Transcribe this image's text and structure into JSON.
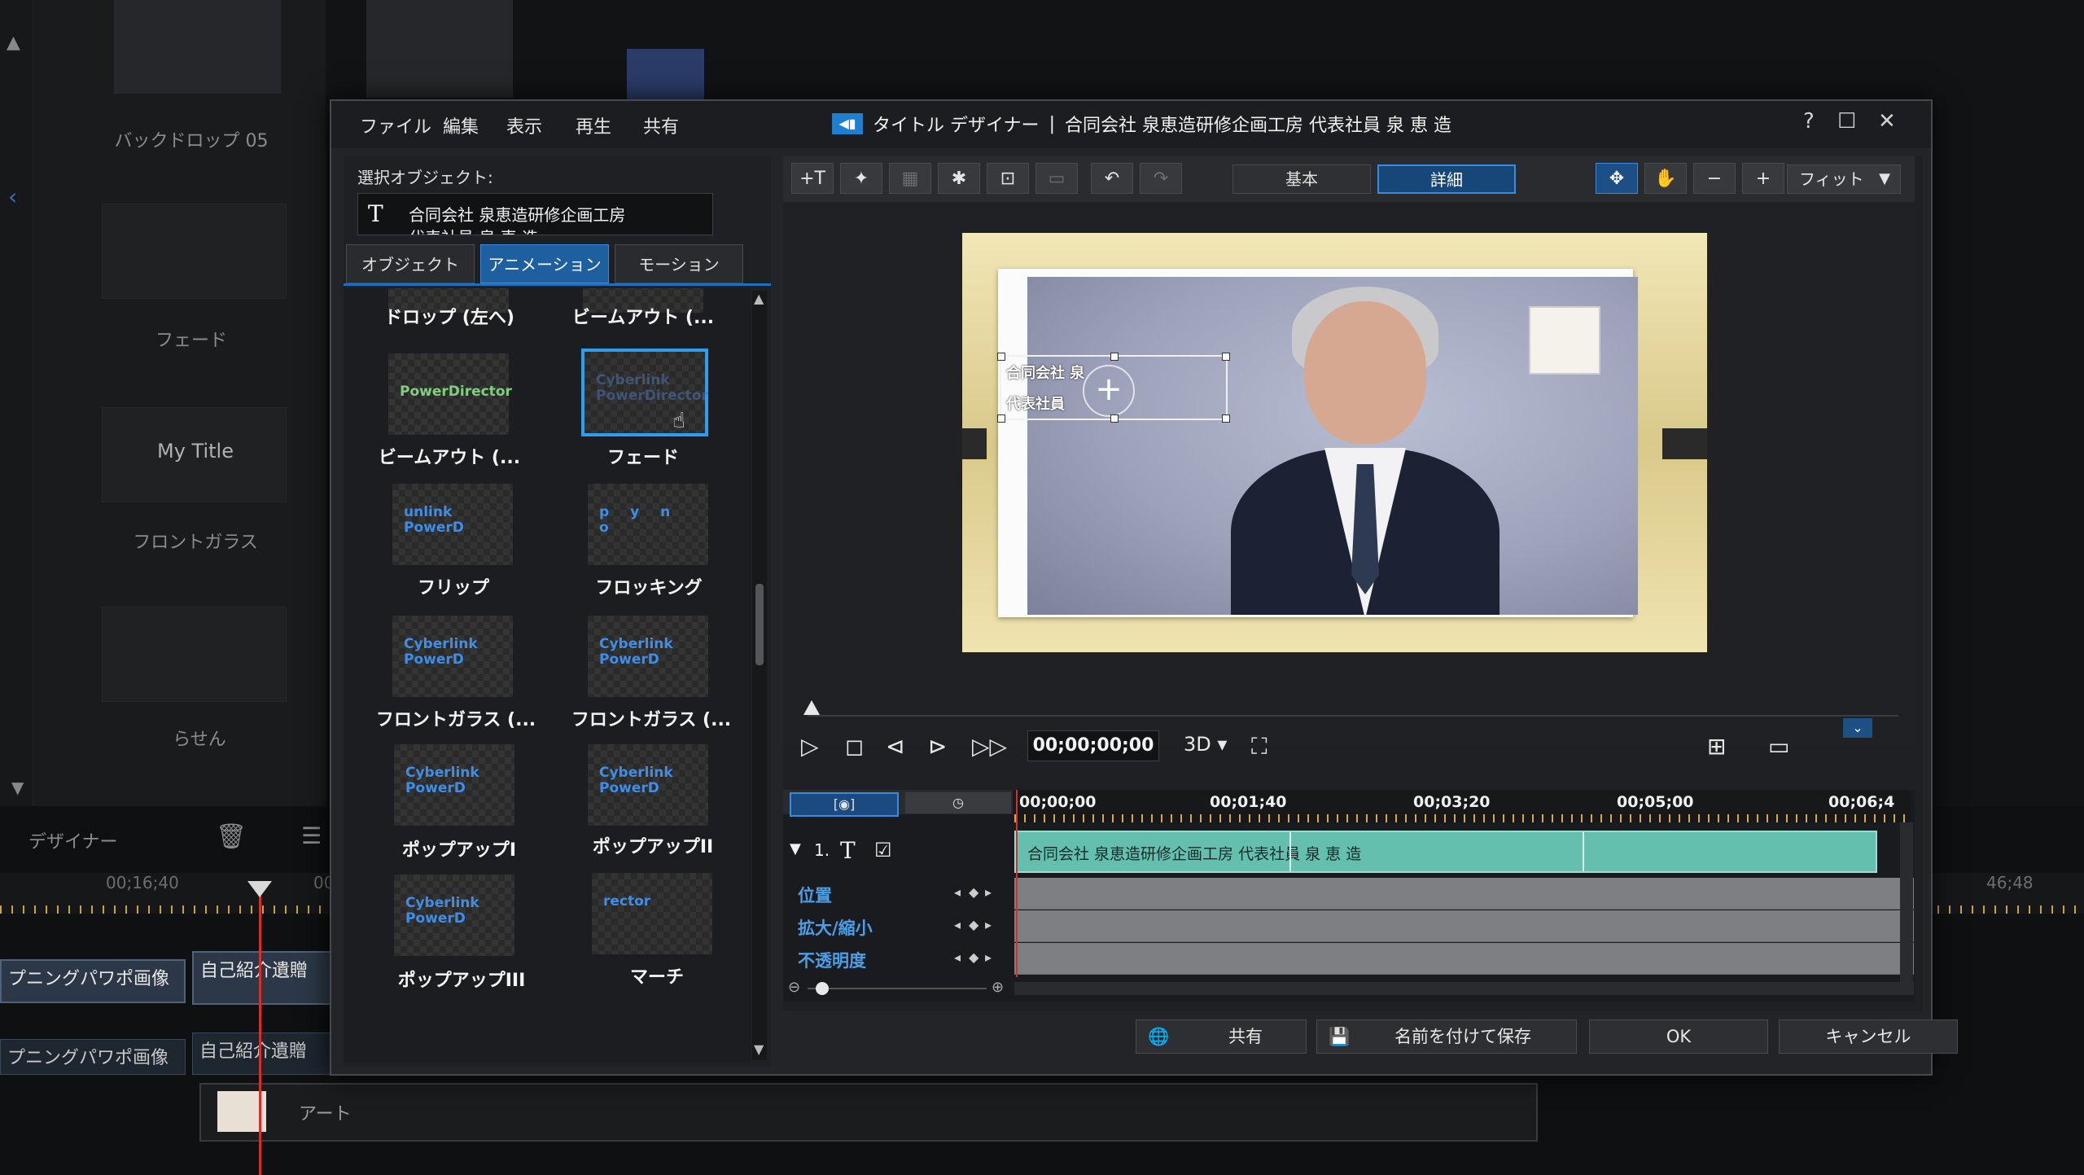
{
  "background": {
    "templates": [
      {
        "label": "バックドロップ 05"
      },
      {
        "label": "フェード"
      },
      {
        "label": "My Title"
      },
      {
        "label": "フロントガラス"
      },
      {
        "label": "らせん"
      }
    ],
    "designer_label": "デザイナー",
    "times": [
      "00;16;40",
      "00",
      "46;48"
    ],
    "clips": [
      {
        "label": "プニングパワポ画像"
      },
      {
        "label": "自己紹介遺贈"
      },
      {
        "label": "プニングパワポ画像"
      },
      {
        "label": "自己紹介遺贈"
      }
    ],
    "art_label": "アート"
  },
  "dialog": {
    "menu": [
      "ファイル",
      "編集",
      "表示",
      "再生",
      "共有"
    ],
    "app_name": "タイトル デザイナー",
    "separator": "|",
    "doc_title": "合同会社 泉恵造研修企画工房 代表社員 泉 恵 造",
    "window_controls": {
      "help": "?",
      "maximize": "☐",
      "close": "✕"
    },
    "selected_object": {
      "label": "選択オブジェクト:",
      "icon": "T",
      "text_line1": "合同会社 泉恵造研修企画工房",
      "text_line2": "代表社員 泉 恵 造"
    },
    "tabs": [
      "オブジェクト",
      "アニメーション",
      "モーション"
    ],
    "effects": [
      {
        "label": "ドロップ (左へ)",
        "thumb": ""
      },
      {
        "label": "ビームアウト (...",
        "thumb": ""
      },
      {
        "label": "ビームアウト (...",
        "thumb": "PowerDirector"
      },
      {
        "label": "フェード",
        "thumb": "Cyberlink PowerDirector"
      },
      {
        "label": "フリップ",
        "thumb": "unlink PowerD"
      },
      {
        "label": "フロッキング",
        "thumb": "p y n o"
      },
      {
        "label": "フロントガラス (...",
        "thumb": "Cyberlink PowerD"
      },
      {
        "label": "フロントガラス (...",
        "thumb": "Cyberlink PowerD"
      },
      {
        "label": "ポップアップI",
        "thumb": "Cyberlink PowerD"
      },
      {
        "label": "ポップアップII",
        "thumb": "Cyberlink PowerD"
      },
      {
        "label": "ポップアップIII",
        "thumb": "Cyberlink PowerD"
      },
      {
        "label": "マーチ",
        "thumb": "rector"
      }
    ],
    "toolbar": {
      "mode_basic": "基本",
      "mode_detail": "詳細",
      "fit": "フィット"
    },
    "preview": {
      "title_line1": "合同会社 泉",
      "title_line2": "代表社員"
    },
    "transport": {
      "timecode": "00;00;00;00",
      "mode_3d": "3D"
    },
    "timeline": {
      "ruler": [
        "00;00;00",
        "00;01;40",
        "00;03;20",
        "00;05;00",
        "00;06;4"
      ],
      "object_index": "1.",
      "clip_text": "合同会社 泉恵造研修企画工房 代表社員  泉  恵  造",
      "properties": [
        "位置",
        "拡大/縮小",
        "不透明度"
      ]
    },
    "buttons": {
      "share": "共有",
      "save_as": "名前を付けて保存",
      "ok": "OK",
      "cancel": "キャンセル"
    }
  },
  "colors": {
    "accent": "#2e9df0",
    "clip": "#64bfae",
    "playhead": "#d0312d"
  }
}
